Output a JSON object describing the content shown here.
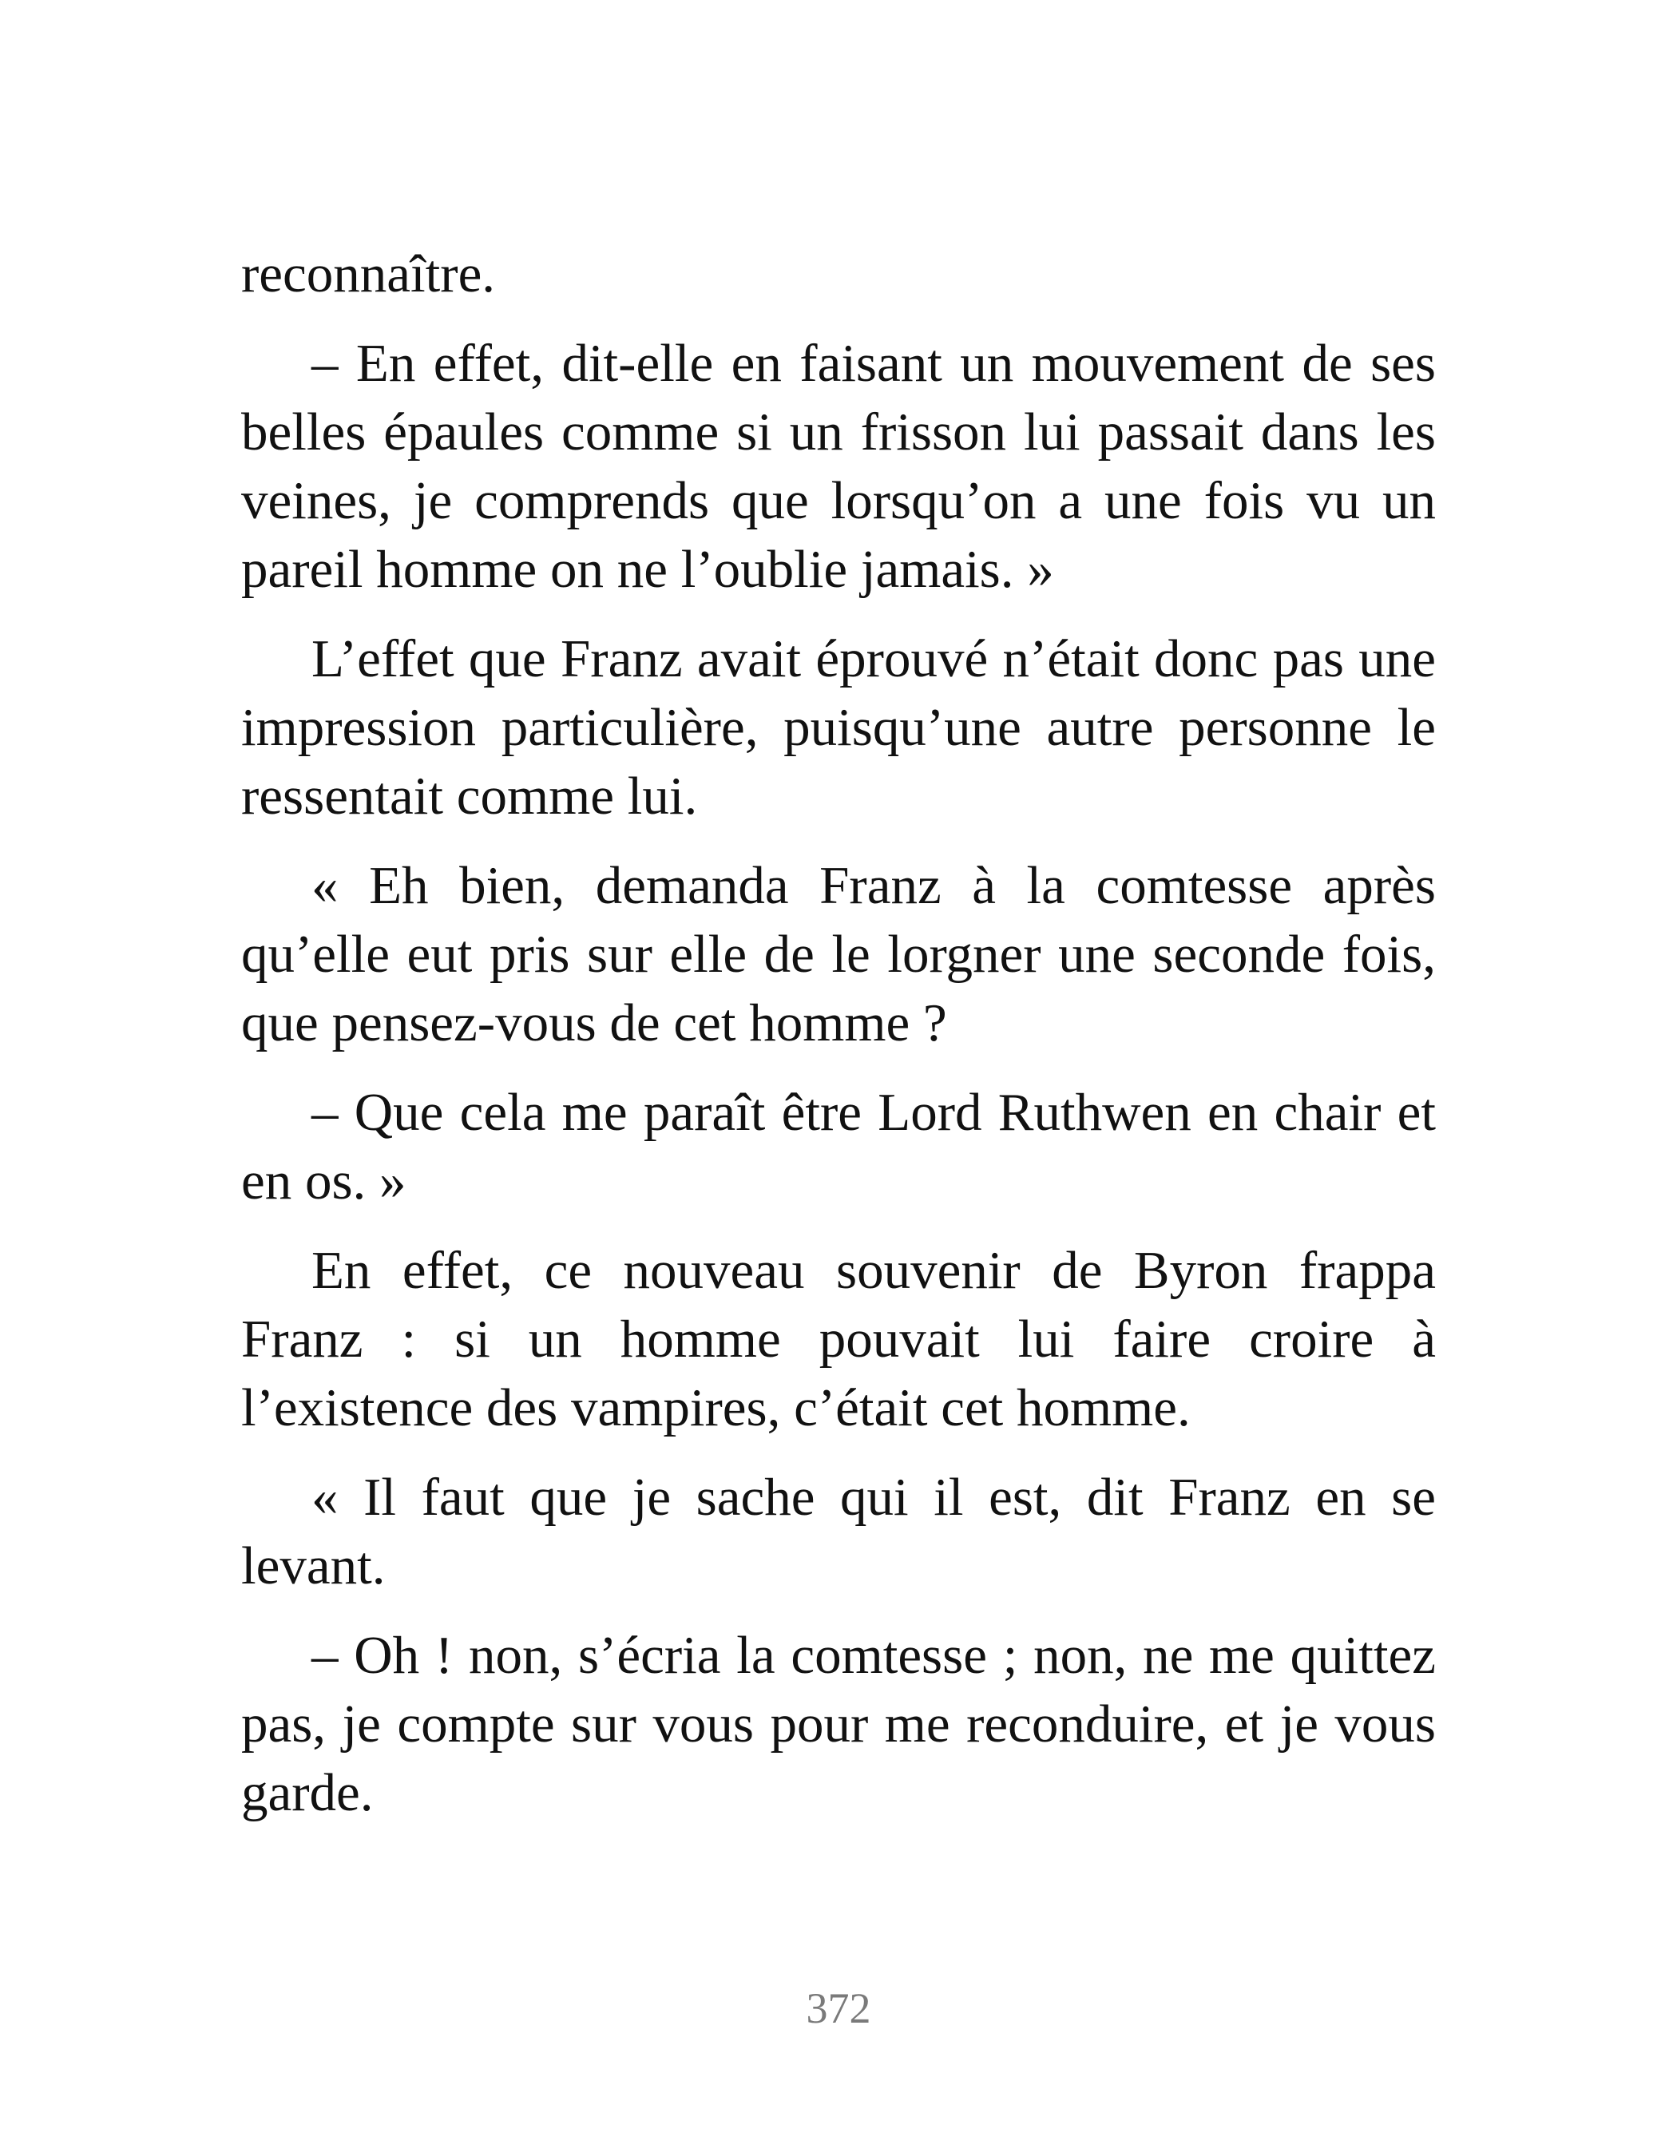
{
  "page": {
    "paragraphs": [
      {
        "text": "reconnaître.",
        "indent": false
      },
      {
        "text": "– En effet, dit-elle en faisant un mouvement de ses belles épaules comme si un frisson lui passait dans les veines, je comprends que lorsqu’on a une fois vu un pareil homme on ne l’oublie jamais. »",
        "indent": true
      },
      {
        "text": "L’effet que Franz avait éprouvé n’était donc pas une impression particulière, puisqu’une autre personne le ressentait comme lui.",
        "indent": true
      },
      {
        "text": "« Eh bien, demanda Franz à la comtesse après qu’elle eut pris sur elle de le lorgner une seconde fois, que pensez-vous de cet homme ?",
        "indent": true
      },
      {
        "text": "– Que cela me paraît être Lord Ruthwen en chair et en os. »",
        "indent": true
      },
      {
        "text": "En effet, ce nouveau souvenir de Byron frappa Franz : si un homme pouvait lui faire croire à l’existence des vampires, c’était cet homme.",
        "indent": true
      },
      {
        "text": "« Il faut que je sache qui il est, dit Franz en se levant.",
        "indent": true
      },
      {
        "text": "– Oh ! non, s’écria la comtesse ; non, ne me quittez pas, je compte sur vous pour me reconduire, et je vous garde.",
        "indent": true
      }
    ],
    "page_number": "372"
  },
  "colors": {
    "text": "#111111",
    "page_number": "#7a7a7a",
    "background": "#ffffff"
  }
}
